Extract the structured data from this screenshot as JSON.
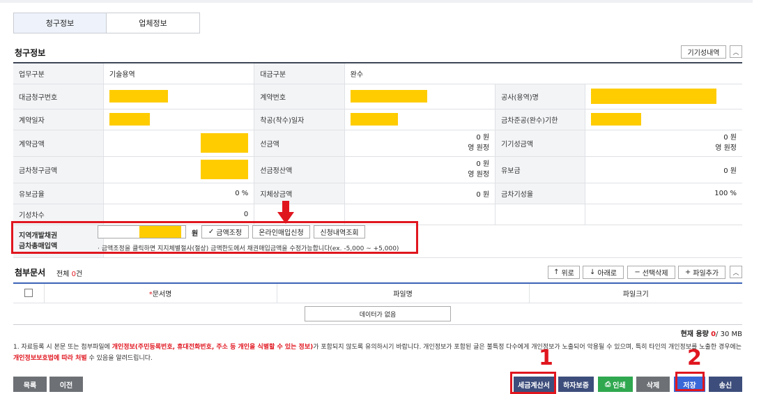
{
  "tabs": [
    "청구정보",
    "업체정보"
  ],
  "billing": {
    "title": "청구정보",
    "history_button": "기기성내역",
    "rows": {
      "work_type_label": "업무구분",
      "work_type_value": "기술용역",
      "payment_type_label": "대금구분",
      "payment_type_value": "완수",
      "claim_no_label": "대금청구번호",
      "contract_no_label": "계약번호",
      "project_name_label": "공사(용역)명",
      "contract_date_label": "계약일자",
      "start_date_label": "착공(착수)일자",
      "completion_deadline_label": "금차준공(완수)기한",
      "contract_amount_label": "계약금액",
      "advance_label": "선금액",
      "advance_value": "0 원",
      "advance_korean": "영 원정",
      "prev_progress_label": "기기성금액",
      "prev_progress_value": "0 원",
      "prev_progress_korean": "영 원정",
      "claim_amount_label": "금차청구금액",
      "advance_settle_label": "선금정산액",
      "advance_settle_value": "0 원",
      "advance_settle_korean": "영 원정",
      "retention_label": "유보금",
      "retention_value": "0 원",
      "retention_rate_label": "유보금율",
      "retention_rate_value": "0 %",
      "delay_penalty_label": "지체상금액",
      "delay_penalty_value": "0 원",
      "progress_rate_label": "금차기성율",
      "progress_rate_value": "100 %",
      "progress_count_label": "기성차수",
      "progress_count_value": "0"
    },
    "region_bond": {
      "label": "지역개발채권\n금차총매입액",
      "unit": "원",
      "adjust_button": "금액조정",
      "online_button": "온라인매입신청",
      "history_button": "신청내역조회",
      "note": "· 금액조정을 클릭하면 지지체별절사(절상) 금액한도에서 채권매입금액을 수정가능합니다(ex. -5,000 ~ +5,000)"
    }
  },
  "attachments": {
    "title": "첨부문서",
    "total_prefix": "전체",
    "total_count": "0",
    "total_suffix": "건",
    "buttons": {
      "up": "위로",
      "down": "아래로",
      "delete": "선택삭제",
      "add": "파일추가"
    },
    "columns": [
      "문서명",
      "파일명",
      "파일크기"
    ],
    "empty_message": "데이터가 없음",
    "capacity_label": "현재 용량",
    "capacity_used": "0",
    "capacity_total": "/ 30 MB"
  },
  "notice": {
    "part1": "1. 자료등록 시 본문 또는 첨부파일에 ",
    "red1": "개인정보(주민등록번호, 휴대전화번호, 주소 등 개인을 식별할 수 있는 정보)",
    "part2": "가 포함되지 않도록 유의하시기 바랍니다. 개인정보가 포함된 글은 불특정 다수에게 개인정보가 노출되어 악용될 수 있으며, 특히 타인의 개인정보를 노출한 경우에는 ",
    "red2": "개인정보보호법에 따라 처벌",
    "part3": " 수 있음을 알려드립니다."
  },
  "footer": {
    "list": "목록",
    "prev": "이전",
    "tax_invoice": "세금계산서",
    "defect": "하자보증",
    "print": "인쇄",
    "delete": "삭제",
    "save": "저장",
    "send": "송신"
  },
  "annotations": {
    "step1": "1",
    "step2": "2"
  },
  "colors": {
    "highlight": "#e0161f",
    "mask": "#ffcc00",
    "primary": "#3a68d8"
  }
}
